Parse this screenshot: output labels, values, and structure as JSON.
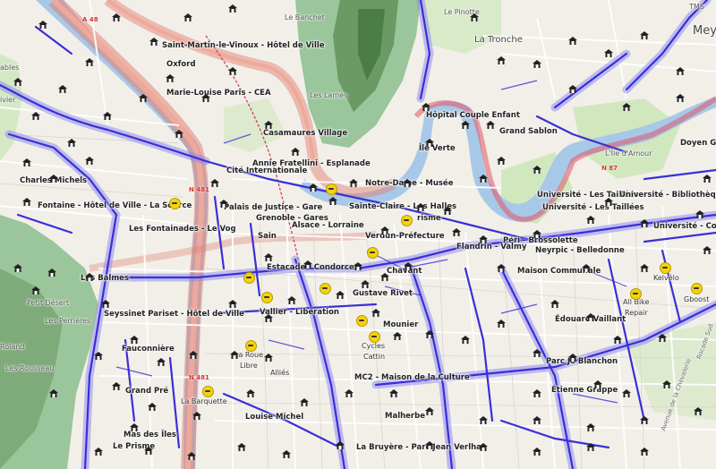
{
  "labels": {
    "saint_martin": "Saint-Martin-le-Vinoux - Hôtel de Ville",
    "oxford": "Oxford",
    "marie_louise": "Marie-Louise Paris - CEA",
    "casamaures": "Casamaures Village",
    "fratellini": "Annie Fratellini - Esplanade",
    "cite_inter": "Cité Internationale",
    "charles_michels": "Charles Michels",
    "fontaine_hdv": "Fontaine - Hôtel de Ville - La Source",
    "notre_dame": "Notre-Dame - Musée",
    "palais_justice": "Palais de Justice - Gare",
    "grenoble_gares": "Grenoble - Gares",
    "alsace_lorraine": "Alsace - Lorraine",
    "sainte_claire": "Sainte-Claire - Les Halles",
    "fontainades": "Les Fontainades - Le Vog",
    "verdun": "Verdun-Préfecture",
    "hopital": "Hôpital Couple Enfant",
    "grand_sablon": "Grand Sablon",
    "ile_verte": "Île Verte",
    "univ_taillees": "Université - Les Taillées",
    "univ_biblio": "Université - Bibliothèques",
    "univ_taillees2": "Université - Les Taillées",
    "univ_condil": "Université - Condil",
    "peri_brossolette": "Péri - Brossolette",
    "flandrin": "Flandrin - Valmy",
    "neyrpic": "Neyrpic - Belledonne",
    "maison_communale": "Maison Communale",
    "kelvelo": "Kelvélo",
    "gboost": "Gboost",
    "all_bike": "All Bike",
    "repair": "Repair",
    "edouard_vaillant": "Édouard Vaillant",
    "estacade": "Estacade - Condorcet",
    "chavant": "Chavant",
    "gustave_rivet": "Gustave Rivet",
    "vallier": "Vallier - Libération",
    "seyssinet": "Seyssinet Pariset - Hôtel de Ville",
    "les_balmes": "Les Balmes",
    "fauconniere": "Fauconnière",
    "la_roue": "La Roue",
    "libre": "Libre",
    "mounier": "Mounier",
    "cycles": "Cycles",
    "cattin": "Cattin",
    "allies": "Alliés",
    "mc2": "MC2 - Maison de la Culture",
    "parc_jo": "Parc Jo Blanchon",
    "etienne_grappe": "Étienne Grappe",
    "grand_pre": "Grand Pré",
    "la_barquette": "La Barquette",
    "louise_michel": "Louise Michel",
    "malherbe": "Malherbe",
    "mas_des_iles": "Mas des Îles",
    "le_prisme": "Le Prisme",
    "la_bruyere": "La Bruyère - Parc Jean Verlhac",
    "sain": "Sain",
    "grisme": "risme",
    "doyen_g": "Doyen G"
  },
  "places": {
    "le_banchet": "Le Banchet",
    "le_pinotte": "Le Pinotte",
    "la_tronche": "La Tronche",
    "les_lames": "Les Lames",
    "petit_desert": "Petit Désert",
    "les_perrieres": "Les Perrières",
    "roland": "Roland",
    "les_rousseau": "Les Rousseau",
    "lile_damour": "L'Île d'Amour",
    "ables": "ables",
    "vivier": "ivier",
    "tms": "TMS",
    "mey": "Mey"
  },
  "roads": {
    "a48": "A 48",
    "n481": "N 481",
    "n481b": "N 481",
    "n87": "N 87",
    "avenue_chevalerie": "Avenue de la Chevalerie",
    "rocade_sud": "Rocade Sud"
  },
  "colors": {
    "cycle_route": "#3a2fd6",
    "cycle_halo": "#8a86f0",
    "motorway": "#e07a6a",
    "motorway_core": "#f0a89a",
    "river": "#a8c8e8",
    "park": "#c8e6b4",
    "forest": "#9bc59a",
    "hill": "#6b9a64",
    "bike_shop": "#f4d20c",
    "rail": "#cc3355"
  },
  "icons": {
    "bike_station": "bike-rental-station-icon",
    "bike_shop": "bicycle-shop-icon"
  }
}
